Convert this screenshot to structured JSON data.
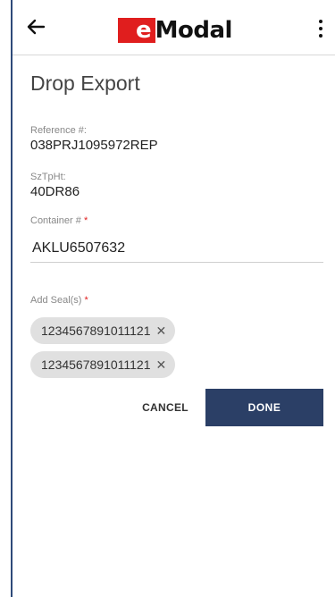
{
  "header": {
    "logo_e": "e",
    "logo_rest": "Modal",
    "back_icon": "arrow-left-icon",
    "menu_icon": "more-vertical-icon"
  },
  "page": {
    "title": "Drop Export"
  },
  "fields": {
    "reference": {
      "label": "Reference #:",
      "value": "038PRJ1095972REP"
    },
    "sztpht": {
      "label": "SzTpHt:",
      "value": "40DR86"
    },
    "container": {
      "label": "Container #",
      "required": "*",
      "value": "AKLU6507632"
    }
  },
  "seals": {
    "label": "Add Seal(s)",
    "required": "*",
    "items": [
      {
        "value": "1234567891011121",
        "remove": "✕"
      },
      {
        "value": "1234567891011121",
        "remove": "✕"
      }
    ]
  },
  "actions": {
    "cancel_label": "CANCEL",
    "done_label": "DONE"
  },
  "colors": {
    "brand_red": "#e01e1e",
    "primary": "#2b3f66",
    "chip_bg": "#e0e0e0"
  }
}
